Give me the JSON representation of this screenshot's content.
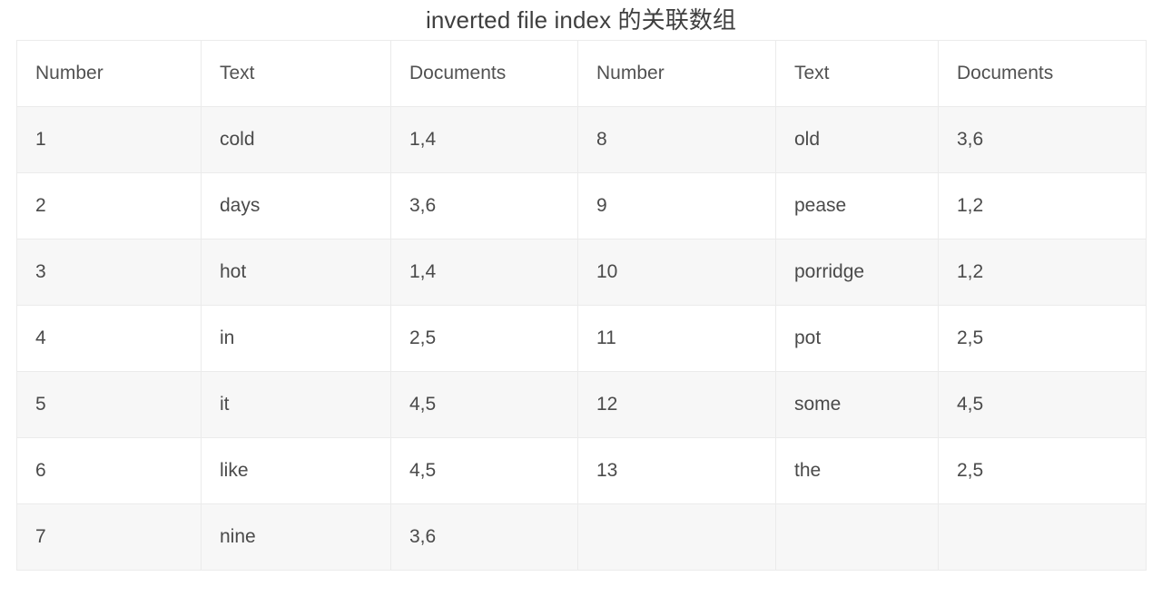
{
  "page": {
    "title": "inverted file index 的关联数组",
    "background_color": "#ffffff",
    "text_color": "#4a4a4a",
    "border_color": "#ebebeb",
    "row_stripe_color": "#f7f7f7"
  },
  "table": {
    "headers": [
      "Number",
      "Text",
      "Documents",
      "Number",
      "Text",
      "Documents"
    ],
    "rows": [
      [
        "1",
        "cold",
        "1,4",
        "8",
        "old",
        "3,6"
      ],
      [
        "2",
        "days",
        "3,6",
        "9",
        "pease",
        "1,2"
      ],
      [
        "3",
        "hot",
        "1,4",
        "10",
        "porridge",
        "1,2"
      ],
      [
        "4",
        "in",
        "2,5",
        "11",
        "pot",
        "2,5"
      ],
      [
        "5",
        "it",
        "4,5",
        "12",
        "some",
        "4,5"
      ],
      [
        "6",
        "like",
        "4,5",
        "13",
        "the",
        "2,5"
      ],
      [
        "7",
        "nine",
        "3,6",
        "",
        "",
        ""
      ]
    ]
  }
}
